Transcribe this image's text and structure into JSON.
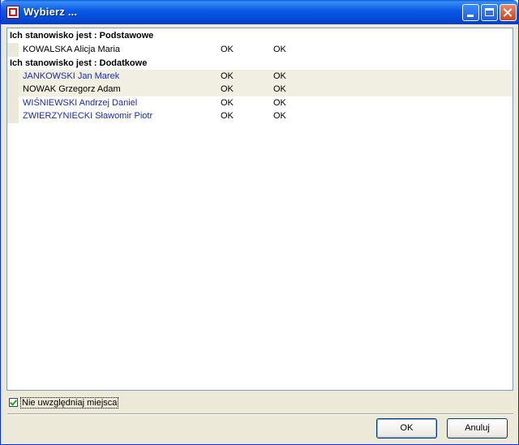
{
  "window": {
    "title": "Wybierz ..."
  },
  "groups": [
    {
      "header": "Ich stanowisko jest :  Podstawowe",
      "rows": [
        {
          "name": "KOWALSKA Alicja Maria",
          "col1": "OK",
          "col2": "OK",
          "name_color": "#000000"
        }
      ]
    },
    {
      "header": "Ich stanowisko jest :  Dodatkowe",
      "rows": [
        {
          "name": "JANKOWSKI Jan Marek",
          "col1": "OK",
          "col2": "OK",
          "name_color": "#1c2ea6"
        },
        {
          "name": "NOWAK Grzegorz Adam",
          "col1": "OK",
          "col2": "OK",
          "name_color": "#000000"
        },
        {
          "name": "WIŚNIEWSKI Andrzej Daniel",
          "col1": "OK",
          "col2": "OK",
          "name_color": "#1c2ea6"
        },
        {
          "name": "ZWIERZYNIECKI Sławomir Piotr",
          "col1": "OK",
          "col2": "OK",
          "name_color": "#1c2ea6"
        }
      ]
    }
  ],
  "options": {
    "ignore_place_label": "Nie uwzględniaj miejsca",
    "ignore_place_checked": true
  },
  "buttons": {
    "ok_label": "OK",
    "cancel_label": "Anuluj"
  }
}
